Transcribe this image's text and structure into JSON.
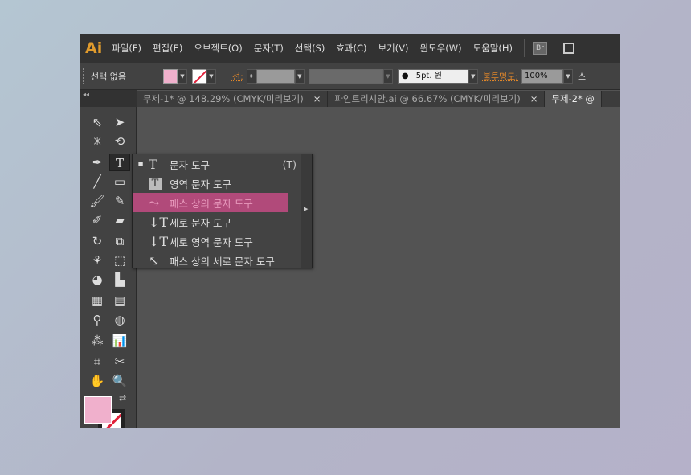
{
  "app": {
    "logo": "Ai"
  },
  "menu": [
    "파일(F)",
    "편집(E)",
    "오브젝트(O)",
    "문자(T)",
    "선택(S)",
    "효과(C)",
    "보기(V)",
    "윈도우(W)",
    "도움말(H)"
  ],
  "bridge_label": "Br",
  "control": {
    "selection": "선택 없음",
    "fill_color": "#f0b0cc",
    "stroke_label": "선:",
    "brush": "5pt. 원",
    "opacity_label": "불투명도:",
    "opacity": "100%",
    "style_label": "스"
  },
  "tabs": [
    {
      "label": "무제-1* @ 148.29% (CMYK/미리보기)",
      "close": "×"
    },
    {
      "label": "파인트리시안.ai @ 66.67% (CMYK/미리보기)",
      "close": "×"
    },
    {
      "label": "무제-2* @",
      "close": ""
    }
  ],
  "toolbar_collapse": "◂◂",
  "flyout": {
    "items": [
      {
        "label": "문자 도구",
        "shortcut": "(T)",
        "icon": "type-icon",
        "glyph": "T",
        "current": true
      },
      {
        "label": "영역 문자 도구",
        "icon": "area-type-icon",
        "glyph": "T"
      },
      {
        "label": "패스 상의 문자 도구",
        "icon": "type-on-path-icon",
        "glyph": "⤳",
        "highlighted": true
      },
      {
        "label": "세로 문자 도구",
        "icon": "vertical-type-icon",
        "glyph": "↓T"
      },
      {
        "label": "세로 영역 문자 도구",
        "icon": "vertical-area-type-icon",
        "glyph": "↓T"
      },
      {
        "label": "패스 상의 세로 문자 도구",
        "icon": "vertical-type-on-path-icon",
        "glyph": "⤡"
      }
    ],
    "bullet": "■",
    "highlight_color": "#b14a7a"
  }
}
